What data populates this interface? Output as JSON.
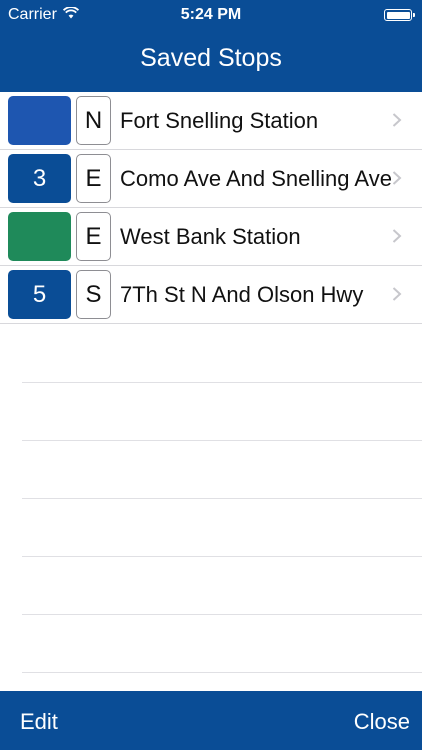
{
  "status_bar": {
    "carrier": "Carrier",
    "time": "5:24 PM",
    "wifi_icon": "wifi-icon",
    "battery_icon": "battery-icon"
  },
  "nav": {
    "title": "Saved Stops"
  },
  "stops": [
    {
      "route": "",
      "route_color": "#1e56b0",
      "direction": "N",
      "name": "Fort Snelling Station"
    },
    {
      "route": "3",
      "route_color": "#0a4d96",
      "direction": "E",
      "name": "Como Ave And Snelling Ave"
    },
    {
      "route": "",
      "route_color": "#1f8a5a",
      "direction": "E",
      "name": "West Bank Station"
    },
    {
      "route": "5",
      "route_color": "#0a4d96",
      "direction": "S",
      "name": "7Th St N And Olson Hwy"
    }
  ],
  "toolbar": {
    "edit_label": "Edit",
    "close_label": "Close"
  },
  "colors": {
    "bar_background": "#0a4d96",
    "separator": "#d8d8dc",
    "chevron": "#c7c7cc"
  }
}
